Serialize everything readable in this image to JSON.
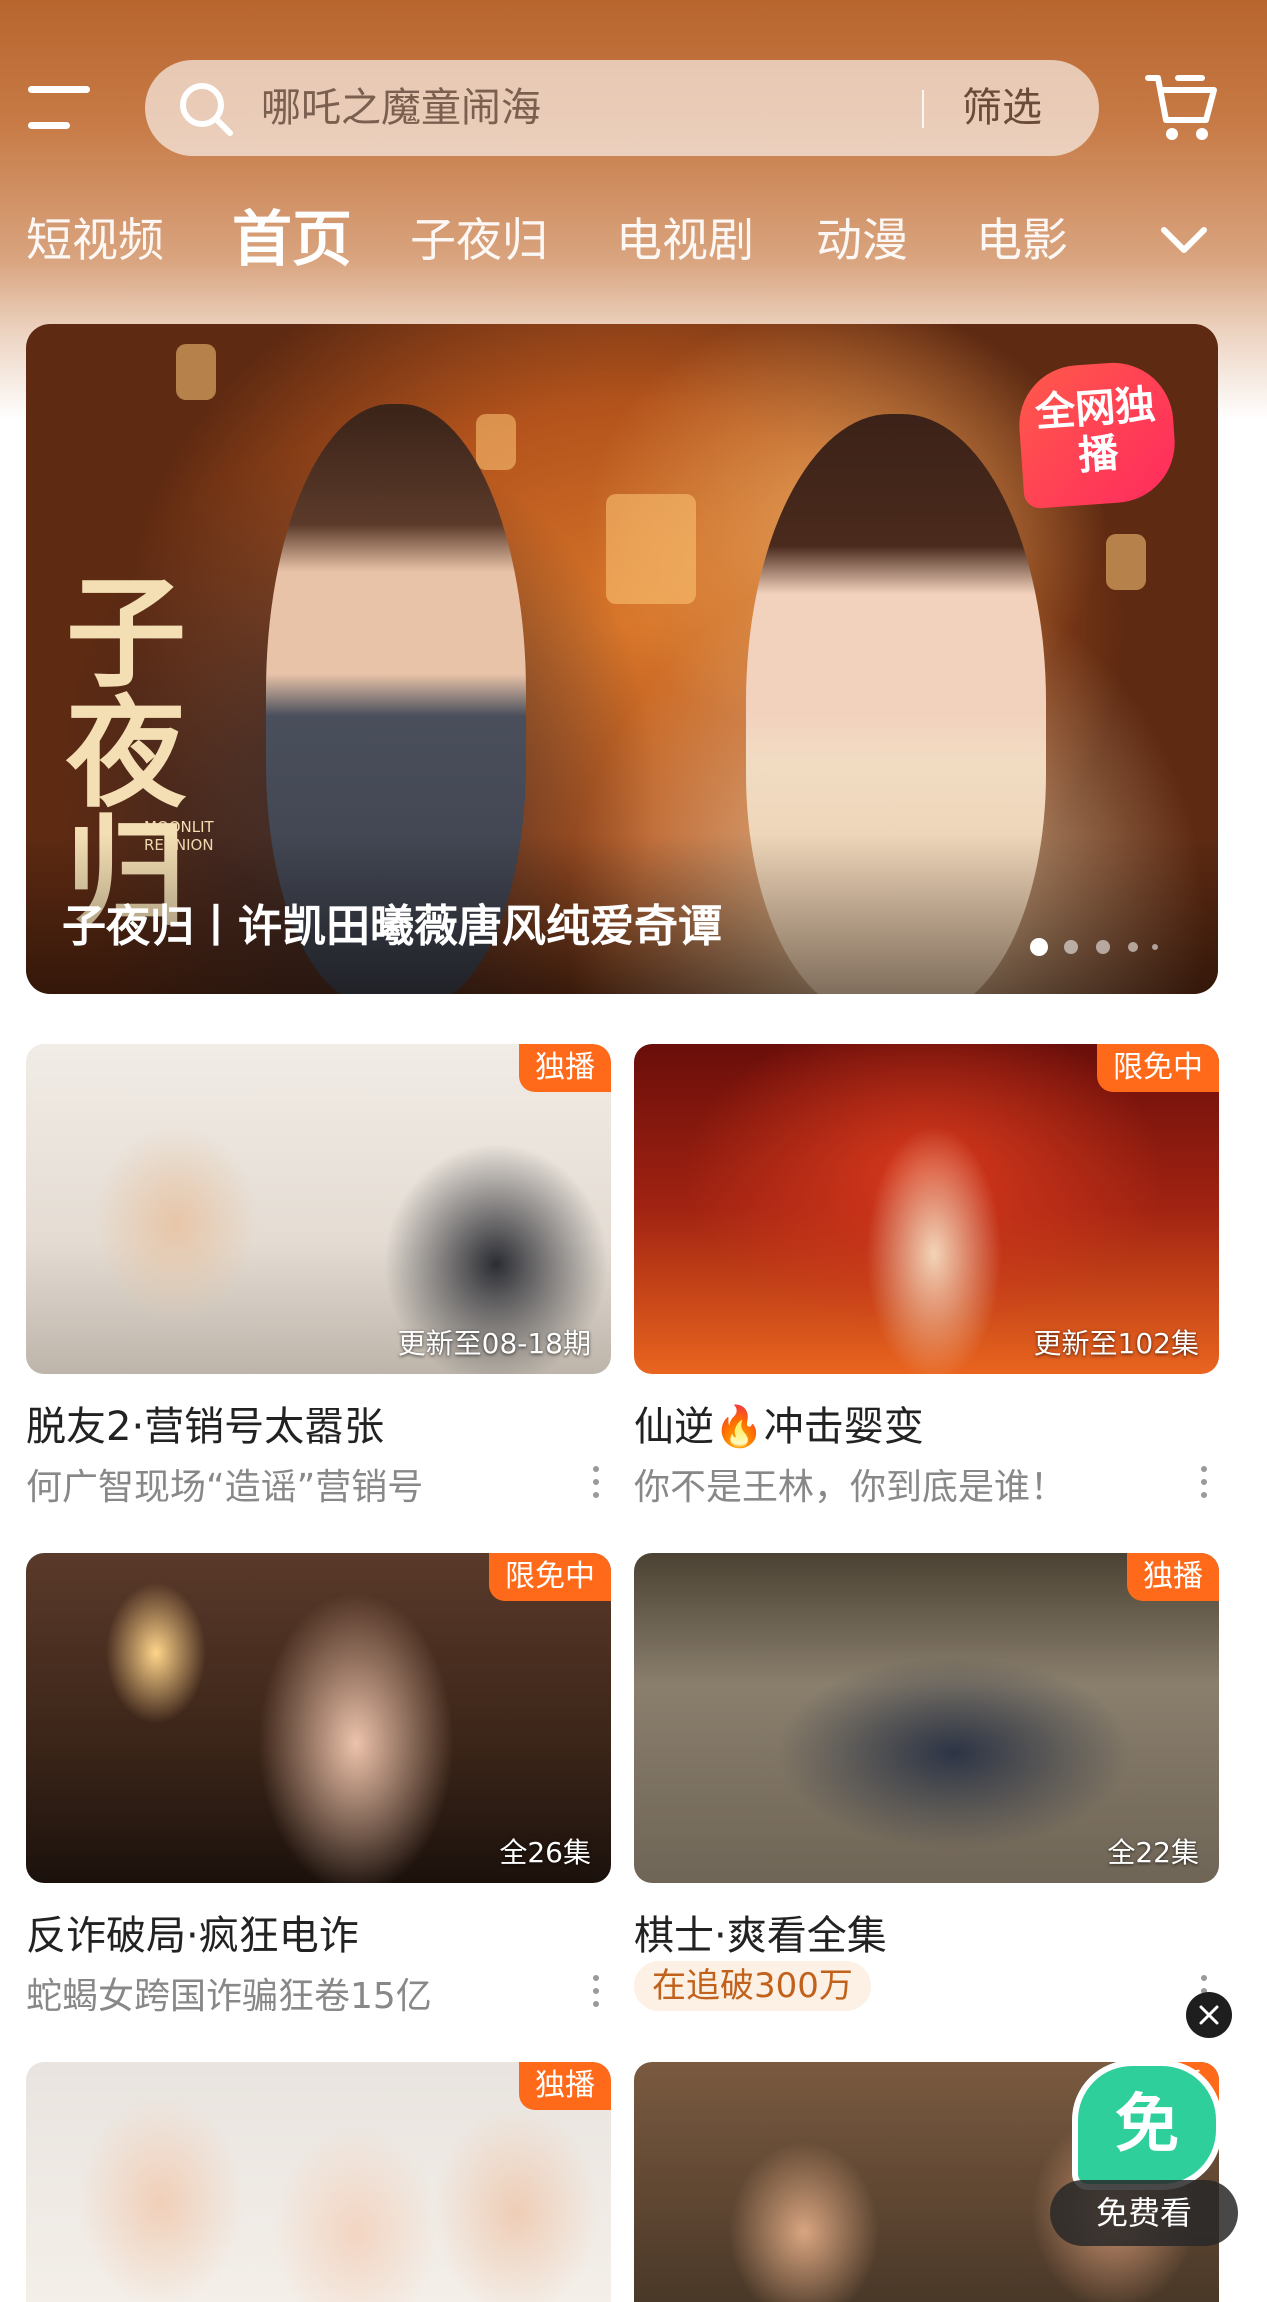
{
  "header": {
    "search_placeholder": "哪吒之魔童闹海",
    "filter_label": "筛选",
    "icons": {
      "menu": "menu-icon",
      "search": "search-icon",
      "cart": "cart-icon",
      "expand": "chevron-down-icon"
    }
  },
  "tabs": [
    {
      "label": "短视频",
      "active": false
    },
    {
      "label": "首页",
      "active": true
    },
    {
      "label": "子夜归",
      "active": false
    },
    {
      "label": "电视剧",
      "active": false
    },
    {
      "label": "动漫",
      "active": false
    },
    {
      "label": "电影",
      "active": false
    }
  ],
  "banner": {
    "logo_text": "子夜归",
    "logo_subtitle": "MOONLIT REUNION",
    "exclusive_badge": "全网独播",
    "caption": "子夜归丨许凯田曦薇唐风纯爱奇谭",
    "slide_count": 5,
    "active_slide": 1
  },
  "cards": [
    {
      "badge": "独播",
      "episode": "更新至08-18期",
      "title": "脱友2·营销号太嚣张",
      "subtitle": "何广智现场“造谣”营销号"
    },
    {
      "badge": "限免中",
      "episode": "更新至102集",
      "title": "仙逆🔥冲击婴变",
      "subtitle": "你不是王林，你到底是谁！"
    },
    {
      "badge": "限免中",
      "episode": "全26集",
      "title": "反诈破局·疯狂电诈",
      "subtitle": "蛇蝎女跨国诈骗狂卷15亿"
    },
    {
      "badge": "独播",
      "episode": "全22集",
      "title": "棋士·爽看全集",
      "hot_tag": "在追破300万"
    },
    {
      "badge": "独播"
    },
    {
      "badge": "独播"
    }
  ],
  "floating": {
    "free_icon_text": "免",
    "free_label": "免费看",
    "close_icon": "close-icon"
  },
  "colors": {
    "badge_orange": "#ff6a1a",
    "header_brown": "#b8652e",
    "free_green": "#2fcf9c"
  }
}
